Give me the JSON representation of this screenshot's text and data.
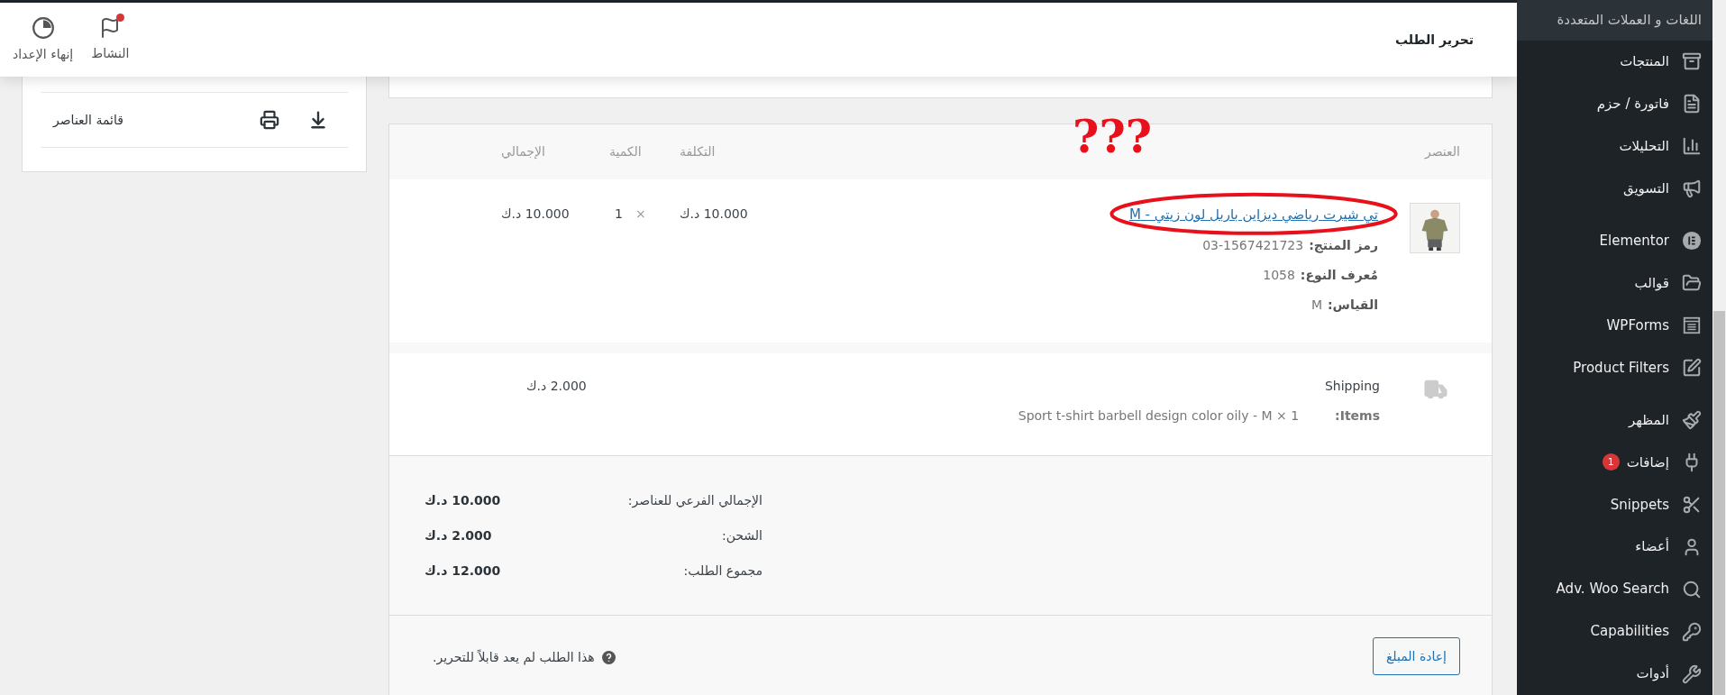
{
  "header": {
    "title": "تحرير الطلب",
    "actions": [
      {
        "kind": "activity",
        "label": "النشاط"
      },
      {
        "kind": "setup",
        "label": "إنهاء الإعداد"
      }
    ]
  },
  "side_panel": {
    "items": [
      {
        "label": "قائمة العناصر"
      }
    ]
  },
  "order_items": {
    "columns": [
      "العنصر",
      "التكلفة",
      "الكمية",
      "الإجمالي"
    ],
    "items": [
      {
        "name": "تي شيرت رياضي ديزاين باربل لون زيتي - M",
        "meta": [
          {
            "label": "رمز المنتج:",
            "value": "03-1567421723"
          },
          {
            "label": "مُعرف النوع:",
            "value": "1058"
          },
          {
            "label": "القياس:",
            "value": "M"
          }
        ],
        "cost": "10.000 د.ك",
        "quantity_sign": "×",
        "quantity": "1",
        "total": "10.000 د.ك"
      }
    ],
    "shipping": {
      "name": "Shipping",
      "items_label": "Items:",
      "items_value": "Sport t-shirt barbell design color oily - M × 1",
      "total": "2.000 د.ك"
    }
  },
  "totals": [
    {
      "label": "الإجمالي الفرعي للعناصر:",
      "value": "10.000 د.ك"
    },
    {
      "label": "الشحن:",
      "value": "2.000 د.ك"
    },
    {
      "label": "مجموع الطلب:",
      "value": "12.000 د.ك"
    }
  ],
  "footer": {
    "refund_button": "إعادة المبلغ",
    "note": "هذا الطلب لم يعد قابلاً للتحرير."
  },
  "annotation": {
    "text": "???"
  },
  "sidebar": {
    "items": [
      {
        "kind": "submenu",
        "label": "اللغات و العملات المتعددة",
        "selected": true
      },
      {
        "kind": "item",
        "label": "المنتجات",
        "selected": false
      },
      {
        "kind": "item",
        "label": "فاتورة / حزم",
        "selected": false
      },
      {
        "kind": "item",
        "label": "التحليلات",
        "selected": false
      },
      {
        "kind": "item",
        "label": "التسويق",
        "selected": false
      },
      {
        "kind": "separator"
      },
      {
        "kind": "item",
        "label": "Elementor",
        "selected": false
      },
      {
        "kind": "item",
        "label": "قوالب",
        "selected": false
      },
      {
        "kind": "item",
        "label": "WPForms",
        "selected": false
      },
      {
        "kind": "item",
        "label": "Product Filters",
        "selected": false
      },
      {
        "kind": "separator"
      },
      {
        "kind": "item",
        "label": "المظهر",
        "selected": false
      },
      {
        "kind": "item",
        "label": "إضافات",
        "badge": "1",
        "selected": false
      },
      {
        "kind": "item",
        "label": "Snippets",
        "selected": false
      },
      {
        "kind": "item",
        "label": "أعضاء",
        "selected": false
      },
      {
        "kind": "item",
        "label": "Adv. Woo Search",
        "selected": false
      },
      {
        "kind": "item",
        "label": "Capabilities",
        "selected": false
      },
      {
        "kind": "item",
        "label": "أدوات",
        "selected": false
      }
    ]
  }
}
